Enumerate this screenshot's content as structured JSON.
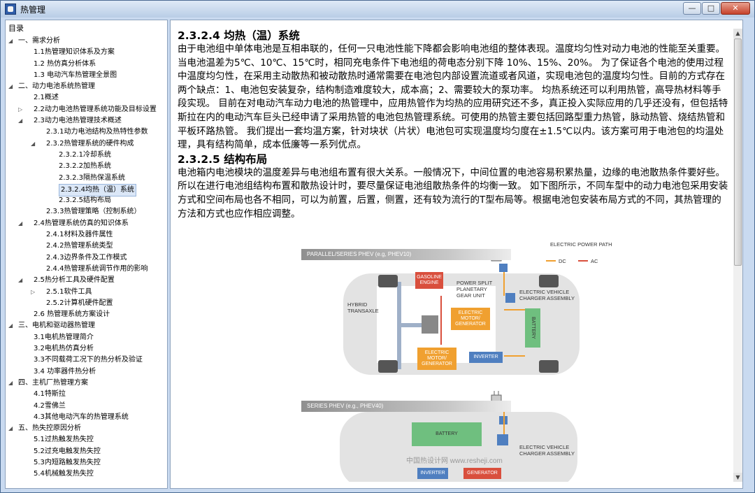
{
  "window": {
    "title": "热管理",
    "minimize_symbol": "—",
    "maximize_symbol": "□",
    "close_symbol": "✕"
  },
  "toc": {
    "header": "目录",
    "items": [
      {
        "level": 0,
        "toggle": "◢",
        "label": "一、需求分析"
      },
      {
        "level": 1,
        "toggle": "",
        "label": "1.1热管理知识体系及方案"
      },
      {
        "level": 1,
        "toggle": "",
        "label": "1.2 热仿真分析体系"
      },
      {
        "level": 1,
        "toggle": "",
        "label": "1.3 电动汽车热管理全景图"
      },
      {
        "level": 0,
        "toggle": "◢",
        "label": "二、动力电池系统热管理"
      },
      {
        "level": 1,
        "toggle": "",
        "label": "2.1概述"
      },
      {
        "level": 1,
        "toggle": "▷",
        "label": "2.2动力电池热管理系统功能及目标设置"
      },
      {
        "level": 1,
        "toggle": "◢",
        "label": "2.3动力电池热管理技术概述"
      },
      {
        "level": 2,
        "toggle": "",
        "label": "2.3.1动力电池结构及热特性参数"
      },
      {
        "level": 2,
        "toggle": "◢",
        "label": "2.3.2热管理系统的硬件构成"
      },
      {
        "level": 3,
        "toggle": "",
        "label": "2.3.2.1冷却系统"
      },
      {
        "level": 3,
        "toggle": "",
        "label": "2.3.2.2加热系统"
      },
      {
        "level": 3,
        "toggle": "",
        "label": "2.3.2.3隔热保温系统"
      },
      {
        "level": 3,
        "toggle": "",
        "label": "2.3.2.4均热（温）系统",
        "selected": true
      },
      {
        "level": 3,
        "toggle": "",
        "label": "2.3.2.5结构布局"
      },
      {
        "level": 2,
        "toggle": "",
        "label": "2.3.3热管理策略（控制系统）"
      },
      {
        "level": 1,
        "toggle": "◢",
        "label": "2.4热管理系统仿真的知识体系"
      },
      {
        "level": 2,
        "toggle": "",
        "label": "2.4.1材料及器件属性"
      },
      {
        "level": 2,
        "toggle": "",
        "label": "2.4.2热管理系统类型"
      },
      {
        "level": 2,
        "toggle": "",
        "label": "2.4.3边界条件及工作模式"
      },
      {
        "level": 2,
        "toggle": "",
        "label": "2.4.4热管理系统调节作用的影响"
      },
      {
        "level": 1,
        "toggle": "◢",
        "label": "2.5热分析工具及硬件配置"
      },
      {
        "level": 2,
        "toggle": "▷",
        "label": "2.5.1软件工具"
      },
      {
        "level": 2,
        "toggle": "",
        "label": "2.5.2计算机硬件配置"
      },
      {
        "level": 1,
        "toggle": "",
        "label": "2.6 热管理系统方案设计"
      },
      {
        "level": 0,
        "toggle": "◢",
        "label": "三、电机和驱动器热管理"
      },
      {
        "level": 1,
        "toggle": "",
        "label": "3.1电机热管理简介"
      },
      {
        "level": 1,
        "toggle": "",
        "label": "3.2电机热仿真分析"
      },
      {
        "level": 1,
        "toggle": "",
        "label": "3.3不同载荷工况下的热分析及验证"
      },
      {
        "level": 1,
        "toggle": "",
        "label": "3.4 功率器件热分析"
      },
      {
        "level": 0,
        "toggle": "◢",
        "label": "四、主机厂热管理方案"
      },
      {
        "level": 1,
        "toggle": "",
        "label": "4.1特斯拉"
      },
      {
        "level": 1,
        "toggle": "",
        "label": "4.2雪佛兰"
      },
      {
        "level": 1,
        "toggle": "",
        "label": "4.3其他电动汽车的热管理系统"
      },
      {
        "level": 0,
        "toggle": "◢",
        "label": "五、热失控原因分析"
      },
      {
        "level": 1,
        "toggle": "",
        "label": "5.1过热触发热失控"
      },
      {
        "level": 1,
        "toggle": "",
        "label": "5.2过充电触发热失控"
      },
      {
        "level": 1,
        "toggle": "",
        "label": "5.3内短路触发热失控"
      },
      {
        "level": 1,
        "toggle": "",
        "label": "5.4机械触发热失控"
      }
    ]
  },
  "article": {
    "h1": "2.3.2.4 均热（温）系统",
    "p1": "由于电池组中单体电池是互相串联的，任何一只电池性能下降都会影响电池组的整体表现。温度均匀性对动力电池的性能至关重要。当电池温差为5℃、10℃、15℃时，相同充电条件下电池组的荷电态分别下降 10%、15%、20%。 为了保证各个电池的使用过程中温度均匀性，在采用主动散热和被动散热时通常需要在电池包内部设置流道或者风道，实现电池包的温度均匀性。目前的方式存在两个缺点：1、电池包安装复杂，结构制造难度较大，成本高；2、需要较大的泵功率。 均热系统还可以利用热管，高导热材料等手段实现。 目前在对电动汽车动力电池的热管理中，应用热管作为均热的应用研究还不多，真正投入实际应用的几乎还没有，但包括特斯拉在内的电动汽车巨头已经申请了采用热管的电池包热管理系统。可使用的热管主要包括回路型重力热管，脉动热管、烧结热管和平板环路热管。 我们提出一套均温方案，针对块状（片状）电池包可实现温度均匀度在±1.5℃以内。该方案可用于电池包的均温处理，具有结构简单，成本低廉等一系列优点。",
    "h2": "2.3.2.5 结构布局",
    "p2": "电池箱内电池模块的温度差异与电池组布置有很大关系。一般情况下，中间位置的电池容易积累热量，边缘的电池散热条件要好些。所以在进行电池组结构布置和散热设计时，要尽量保证电池组散热条件的均衡一致。 如下图所示，不同车型中的动力电池包采用安装方式和空间布局也各不相同，可以为前置，后置，侧置，还有较为流行的T型布局等。根据电池包安装布局方式的不同，其热管理的方法和方式也应作相应调整。"
  },
  "figure": {
    "title1": "PARALLEL/SERIES PHEV (e.g, PHEV10)",
    "title2": "SERIES PHEV (e.g., PHEV40)",
    "legend_title": "ELECTRIC POWER PATH",
    "legend_dc": "DC",
    "legend_ac": "AC",
    "gasoline_engine": "GASOLINE ENGINE",
    "power_split": "POWER SPLIT PLANETARY GEAR UNIT",
    "hybrid_transaxle": "HYBRID TRANSAXLE",
    "motor_generator_1": "ELECTRIC MOTOR/ GENERATOR",
    "motor_generator_2": "ELECTRIC MOTOR/ GENERATOR",
    "inverter": "INVERTER",
    "battery": "BATTERY",
    "charger": "ELECTRIC VEHICLE CHARGER ASSEMBLY",
    "battery2": "BATTERY",
    "charger2": "ELECTRIC VEHICLE CHARGER ASSEMBLY",
    "inverter2": "INVERTER",
    "generator": "GENERATOR",
    "watermark": "中国热设计网  www.resheji.com"
  },
  "colors": {
    "selection": "#dbe7f7",
    "orange": "#f0a030",
    "red": "#d94f3d",
    "blue": "#4f7fc0",
    "green": "#6fbf7f"
  }
}
